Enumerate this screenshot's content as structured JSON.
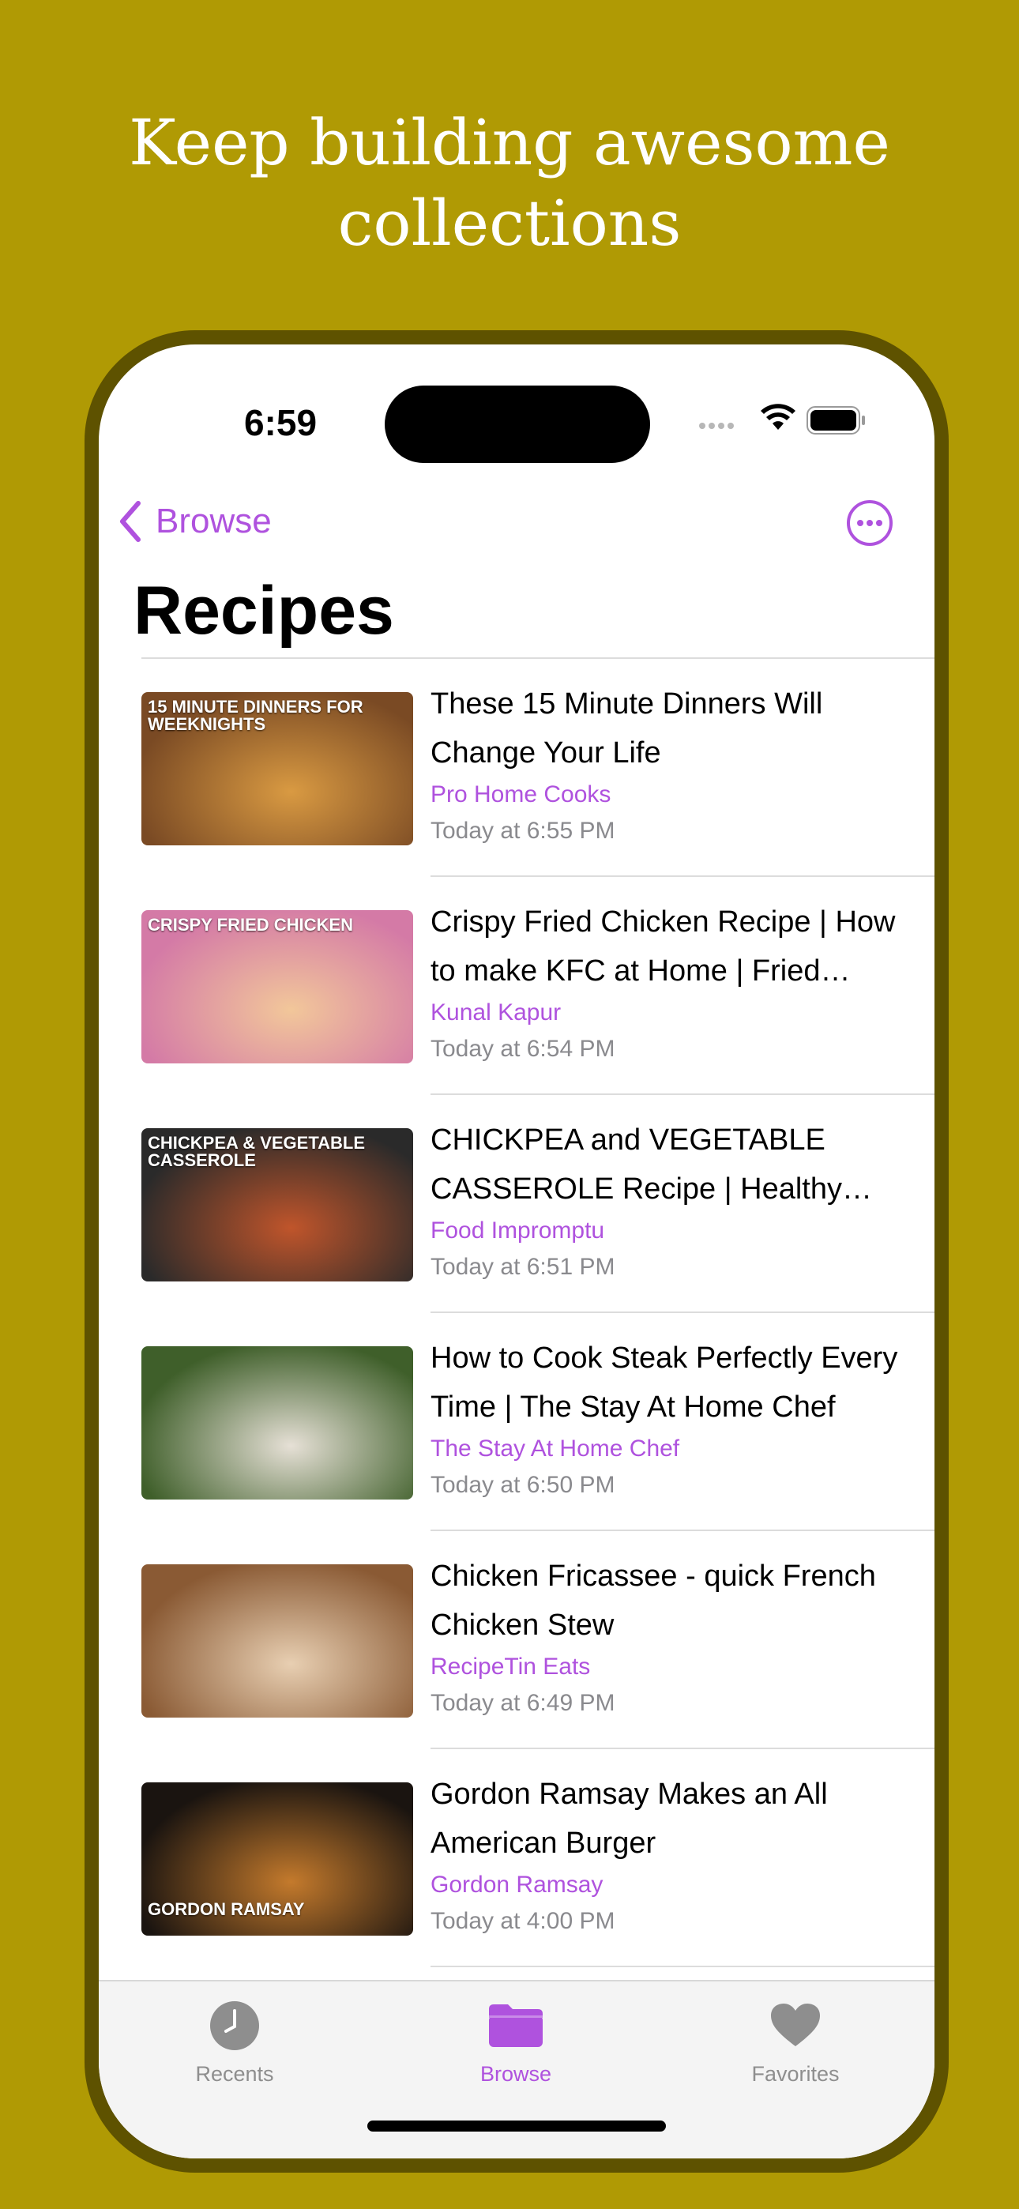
{
  "headline": {
    "line1": "Keep building awesome",
    "line2": "collections"
  },
  "status_bar": {
    "time": "6:59"
  },
  "nav": {
    "back_label": "Browse",
    "more_icon": "ellipsis-circle-icon"
  },
  "page_title": "Recipes",
  "items": [
    {
      "title": "These 15 Minute Dinners Will Change Your Life",
      "channel": "Pro Home Cooks",
      "date": "Today at 6:55 PM",
      "thumb_text": "15 MINUTE DINNERS FOR WEEKNIGHTS",
      "thumb_colors": [
        "#7a4a24",
        "#d99a42"
      ]
    },
    {
      "title": "Crispy Fried Chicken Recipe | How to make KFC at Home | Fried Chicken",
      "channel": "Kunal Kapur",
      "date": "Today at 6:54 PM",
      "thumb_text": "CRISPY FRIED CHICKEN",
      "thumb_colors": [
        "#d47aa6",
        "#f2c79a"
      ]
    },
    {
      "title": "CHICKPEA and VEGETABLE CASSEROLE Recipe | Healthy Vegetarian",
      "channel": "Food Impromptu",
      "date": "Today at 6:51 PM",
      "thumb_text": "CHICKPEA & VEGETABLE CASSEROLE",
      "thumb_colors": [
        "#2a2a2a",
        "#c0552b"
      ]
    },
    {
      "title": "How to Cook Steak Perfectly Every Time | The Stay At Home Chef",
      "channel": "The Stay At Home Chef",
      "date": "Today at 6:50 PM",
      "thumb_text": "",
      "thumb_colors": [
        "#3f5f2a",
        "#e6e0d6"
      ]
    },
    {
      "title": "Chicken Fricassee - quick French Chicken Stew",
      "channel": "RecipeTin Eats",
      "date": "Today at 6:49 PM",
      "thumb_text": "",
      "thumb_colors": [
        "#8a5a34",
        "#e8cfb2"
      ]
    },
    {
      "title": "Gordon Ramsay Makes an All American Burger",
      "channel": "Gordon Ramsay",
      "date": "Today at 4:00 PM",
      "thumb_text": "GORDON RAMSAY",
      "thumb_colors": [
        "#1a1410",
        "#c47a2c"
      ]
    }
  ],
  "tabs": [
    {
      "label": "Recents",
      "icon": "clock-icon",
      "active": false
    },
    {
      "label": "Browse",
      "icon": "folder-icon",
      "active": true
    },
    {
      "label": "Favorites",
      "icon": "heart-icon",
      "active": false
    }
  ],
  "colors": {
    "background": "#b09a04",
    "accent": "#af52de",
    "secondary_text": "#8a8a8e",
    "inactive_tab": "#8e8e8e"
  }
}
